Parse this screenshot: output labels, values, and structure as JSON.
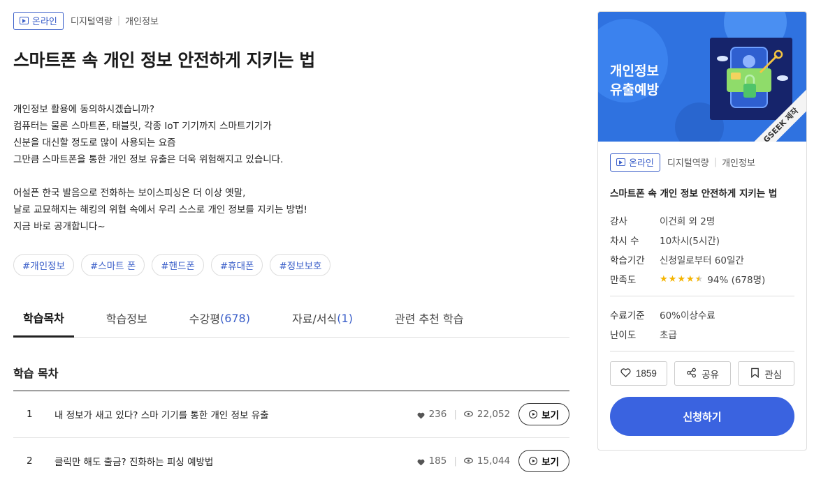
{
  "course": {
    "badge_label": "온라인",
    "category": "디지털역량",
    "subcategory": "개인정보",
    "title": "스마트폰 속 개인 정보 안전하게 지키는 법"
  },
  "description": {
    "lines": [
      "개인정보 활용에 동의하시겠습니까?",
      "컴퓨터는 물론 스마트폰, 태블릿, 각종 IoT 기기까지 스마트기기가",
      "신분을 대신할 정도로 많이 사용되는 요즘",
      "그만큼 스마트폰을 통한 개인 정보 유출은 더욱 위험해지고 있습니다.",
      "",
      "어설픈 한국 발음으로 전화하는 보이스피싱은 더 이상 옛말,",
      "날로 교묘해지는 해킹의 위협 속에서 우리 스스로 개인 정보를 지키는 방법!",
      "지금 바로 공개합니다~"
    ]
  },
  "tags": [
    "#개인정보",
    "#스마트 폰",
    "#핸드폰",
    "#휴대폰",
    "#정보보호"
  ],
  "tabs": [
    {
      "label": "학습목차",
      "count": ""
    },
    {
      "label": "학습정보",
      "count": ""
    },
    {
      "label": "수강평",
      "count": "(678)"
    },
    {
      "label": "자료/서식",
      "count": "(1)"
    },
    {
      "label": "관련 추천 학습",
      "count": ""
    }
  ],
  "toc": {
    "section_title": "학습 목차",
    "view_label": "보기",
    "rows": [
      {
        "num": "1",
        "title": "내 정보가 새고 있다? 스마 기기를 통한 개인 정보 유출",
        "likes": "236",
        "views": "22,052"
      },
      {
        "num": "2",
        "title": "클릭만 해도 출금? 진화하는 피싱 예방법",
        "likes": "185",
        "views": "15,044"
      }
    ]
  },
  "card": {
    "thumb_line1": "개인정보",
    "thumb_line2": "유출예방",
    "thumb_ribbon": "GSEEK 제작",
    "badge_label": "온라인",
    "category": "디지털역량",
    "subcategory": "개인정보",
    "title": "스마트폰 속 개인 정보 안전하게 지키는 법",
    "info": [
      {
        "k": "강사",
        "v": "이건희 외 2명"
      },
      {
        "k": "차시 수",
        "v": "10차시(5시간)"
      },
      {
        "k": "학습기간",
        "v": "신청일로부터 60일간"
      }
    ],
    "rating_label": "만족도",
    "rating_text": "94% (678명)",
    "rating_stars": 4.5,
    "info2": [
      {
        "k": "수료기준",
        "v": "60%이상수료"
      },
      {
        "k": "난이도",
        "v": "초급"
      }
    ],
    "like_count": "1859",
    "share_label": "공유",
    "fav_label": "관심",
    "apply_label": "신청하기"
  },
  "colors": {
    "accent": "#3a63e0",
    "star": "#f5b400",
    "thumb_bg": "#2f72e0"
  }
}
